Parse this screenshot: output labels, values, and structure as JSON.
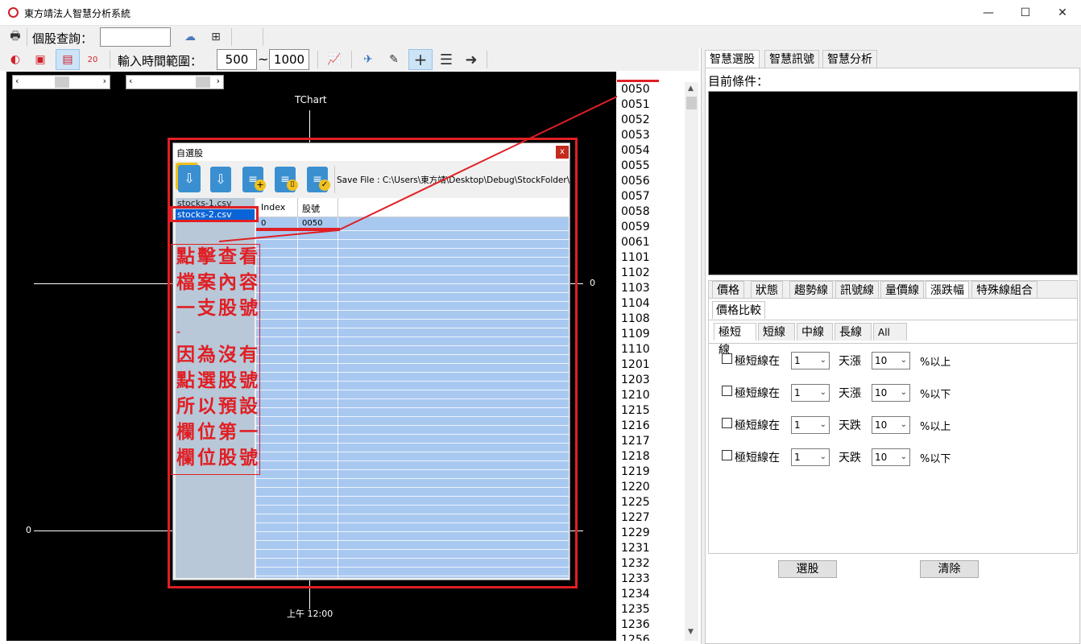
{
  "window": {
    "title": "東方靖法人智慧分析系統",
    "controls": [
      "—",
      "☐",
      "✕"
    ]
  },
  "toolbar1": {
    "stock_query_label": "個股查詢：",
    "stock_query_value": ""
  },
  "toolbar2": {
    "time_range_label": "輸入時間範圍：",
    "range_from": "500",
    "range_tilde": "~",
    "range_to": "1000"
  },
  "chart": {
    "title": "TChart",
    "y_label_right": "0",
    "y_label_left": "0",
    "x_label": "上午 12:00"
  },
  "dialog": {
    "title": "自選股",
    "close": "x",
    "save_file_text": "Save File : C:\\Users\\東方靖\\Desktop\\Debug\\StockFolder\\Sto",
    "files": [
      "stocks-1.csv",
      "stocks-2.csv"
    ],
    "selected_file_index": 1,
    "columns": [
      "Index",
      "股號"
    ],
    "rows": [
      [
        "0",
        "0050"
      ]
    ]
  },
  "annotation": {
    "lines": [
      "點擊查看",
      "檔案內容",
      "一支股號",
      "-",
      "因為沒有",
      "點選股號",
      "所以預設",
      "欄位第一",
      "欄位股號"
    ]
  },
  "stock_list": [
    "0050",
    "0051",
    "0052",
    "0053",
    "0054",
    "0055",
    "0056",
    "0057",
    "0058",
    "0059",
    "0061",
    "1101",
    "1102",
    "1103",
    "1104",
    "1108",
    "1109",
    "1110",
    "1201",
    "1203",
    "1210",
    "1215",
    "1216",
    "1217",
    "1218",
    "1219",
    "1220",
    "1225",
    "1227",
    "1229",
    "1231",
    "1232",
    "1233",
    "1234",
    "1235",
    "1236",
    "1256"
  ],
  "right_panel": {
    "top_tabs": [
      "智慧選股",
      "智慧訊號",
      "智慧分析"
    ],
    "current_condition_label": "目前條件：",
    "mid_tabs": [
      "價格",
      "狀態",
      "趨勢線",
      "訊號線",
      "量價線",
      "漲跌幅",
      "特殊線組合"
    ],
    "sub_tab": "價格比較",
    "range_tabs": [
      "極短線",
      "短線",
      "中線",
      "長線",
      "All"
    ],
    "conditions": [
      {
        "label": "極短線在",
        "days": "1",
        "verb": "天漲",
        "pct": "10",
        "dir": "%以上"
      },
      {
        "label": "極短線在",
        "days": "1",
        "verb": "天漲",
        "pct": "10",
        "dir": "%以下"
      },
      {
        "label": "極短線在",
        "days": "1",
        "verb": "天跌",
        "pct": "10",
        "dir": "%以上"
      },
      {
        "label": "極短線在",
        "days": "1",
        "verb": "天跌",
        "pct": "10",
        "dir": "%以下"
      }
    ],
    "select_button": "選股",
    "clear_button": "清除"
  },
  "colors": {
    "accent_red": "#e01f24",
    "grid_blue": "#a8c8f0",
    "selected_blue": "#0a64d7"
  }
}
